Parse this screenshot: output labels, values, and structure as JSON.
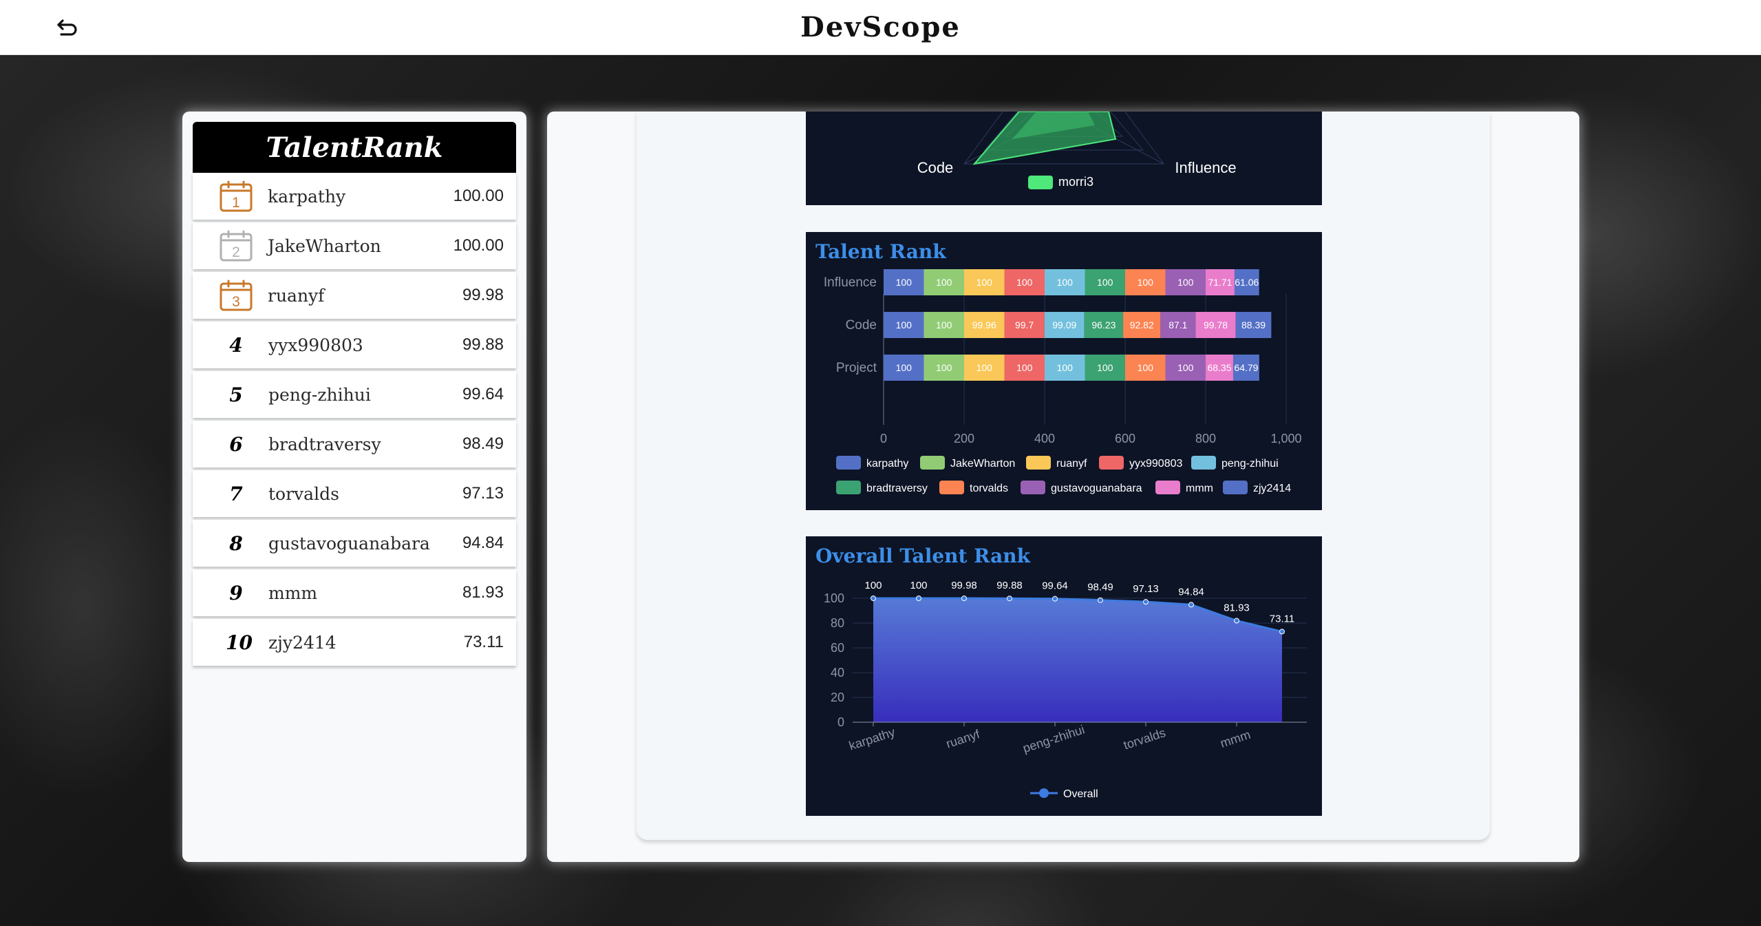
{
  "app": {
    "title": "DevScope"
  },
  "icons": {
    "back": "return-arrow-icon",
    "calendar": "calendar-icon"
  },
  "colors": {
    "gold": "#c8782b",
    "silver": "#b0b0b0",
    "chart_bg": "#0d1426",
    "title_blue": "#3d8fe8"
  },
  "talent_rank": {
    "title": "TalentRank",
    "rows": [
      {
        "rank": "1",
        "name": "karpathy",
        "score": "100.00",
        "medal": "gold"
      },
      {
        "rank": "2",
        "name": "JakeWharton",
        "score": "100.00",
        "medal": "silver"
      },
      {
        "rank": "3",
        "name": "ruanyf",
        "score": "99.98",
        "medal": "gold"
      },
      {
        "rank": "4",
        "name": "yyx990803",
        "score": "99.88"
      },
      {
        "rank": "5",
        "name": "peng-zhihui",
        "score": "99.64"
      },
      {
        "rank": "6",
        "name": "bradtraversy",
        "score": "98.49"
      },
      {
        "rank": "7",
        "name": "torvalds",
        "score": "97.13"
      },
      {
        "rank": "8",
        "name": "gustavoguanabara",
        "score": "94.84"
      },
      {
        "rank": "9",
        "name": "mmm",
        "score": "81.93"
      },
      {
        "rank": "10",
        "name": "zjy2414",
        "score": "73.11"
      }
    ]
  },
  "radar": {
    "axis_labels": [
      "Code",
      "Influence"
    ],
    "legend": "morri3",
    "legend_color": "#4ee87b"
  },
  "chart_data": [
    {
      "type": "bar",
      "stacked": true,
      "orientation": "horizontal",
      "title": "Talent Rank",
      "categories": [
        "Influence",
        "Code",
        "Project"
      ],
      "xlim": [
        0,
        1000
      ],
      "xticks": [
        "0",
        "200",
        "400",
        "600",
        "800",
        "1,000"
      ],
      "legend_position": "bottom",
      "series": [
        {
          "name": "karpathy",
          "color": "#5470c6",
          "values": [
            100,
            100,
            100
          ]
        },
        {
          "name": "JakeWharton",
          "color": "#91cc75",
          "values": [
            100,
            100,
            100
          ]
        },
        {
          "name": "ruanyf",
          "color": "#fac858",
          "values": [
            100,
            99.96,
            100
          ]
        },
        {
          "name": "yyx990803",
          "color": "#ee6666",
          "values": [
            100,
            99.7,
            100
          ]
        },
        {
          "name": "peng-zhihui",
          "color": "#73c0de",
          "values": [
            100,
            99.09,
            100
          ]
        },
        {
          "name": "bradtraversy",
          "color": "#3ba272",
          "values": [
            100,
            96.23,
            100
          ]
        },
        {
          "name": "torvalds",
          "color": "#fc8452",
          "values": [
            100,
            92.82,
            100
          ]
        },
        {
          "name": "gustavoguanabara",
          "color": "#9a60b4",
          "values": [
            100,
            87.1,
            100
          ]
        },
        {
          "name": "mmm",
          "color": "#ea7ccc",
          "values": [
            71.71,
            99.78,
            68.35
          ]
        },
        {
          "name": "zjy2414",
          "color": "#5470c6",
          "values": [
            61.06,
            88.39,
            64.79
          ]
        }
      ]
    },
    {
      "type": "area",
      "title": "Overall Talent Rank",
      "categories": [
        "karpathy",
        "JakeWharton",
        "ruanyf",
        "yyx990803",
        "peng-zhihui",
        "bradtraversy",
        "torvalds",
        "gustavoguanabara",
        "mmm",
        "zjy2414"
      ],
      "x_tick_labels": [
        "karpathy",
        "ruanyf",
        "peng-zhihui",
        "torvalds",
        "mmm"
      ],
      "ylim": [
        0,
        100
      ],
      "yticks": [
        "0",
        "20",
        "40",
        "60",
        "80",
        "100"
      ],
      "series": [
        {
          "name": "Overall",
          "values": [
            100,
            100,
            99.98,
            99.88,
            99.64,
            98.49,
            97.13,
            94.84,
            81.93,
            73.11
          ],
          "labels": [
            "100",
            "100",
            "99.98",
            "99.88",
            "99.64",
            "98.49",
            "97.13",
            "94.84",
            "81.93",
            "73.11"
          ]
        }
      ],
      "legend_position": "bottom"
    }
  ]
}
